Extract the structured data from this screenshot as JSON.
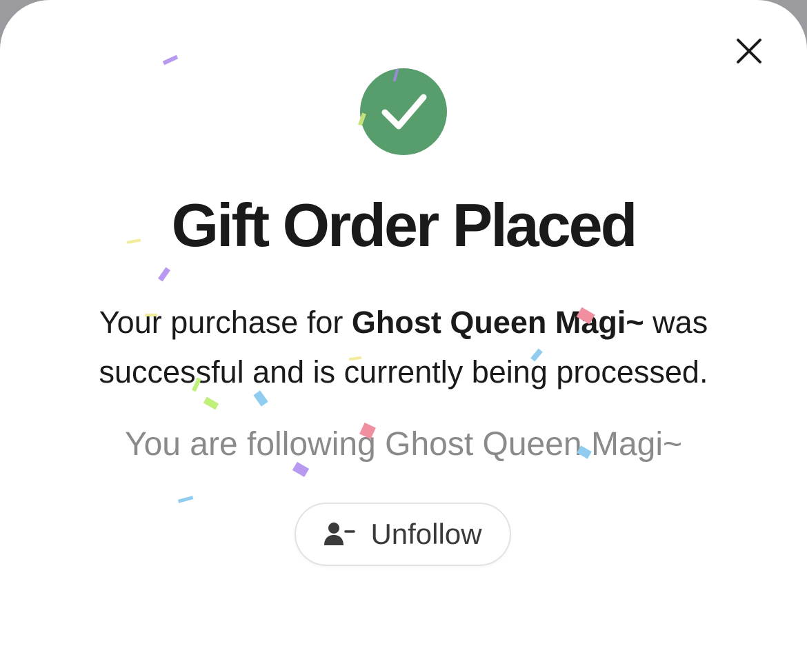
{
  "dialog": {
    "title": "Gift Order Placed",
    "message_before": "Your purchase for ",
    "recipient_name": "Ghost Queen Magi~",
    "message_after": " was successful and is currently being processed.",
    "following_text": "You are following Ghost Queen Magi~",
    "unfollow_label": "Unfollow",
    "close_icon": "close-icon",
    "success_icon": "checkmark-icon",
    "unfollow_icon": "user-minus-icon"
  },
  "colors": {
    "success_green": "#579e6c",
    "text_primary": "#1a1a1a",
    "text_muted": "#8a8a8a"
  }
}
